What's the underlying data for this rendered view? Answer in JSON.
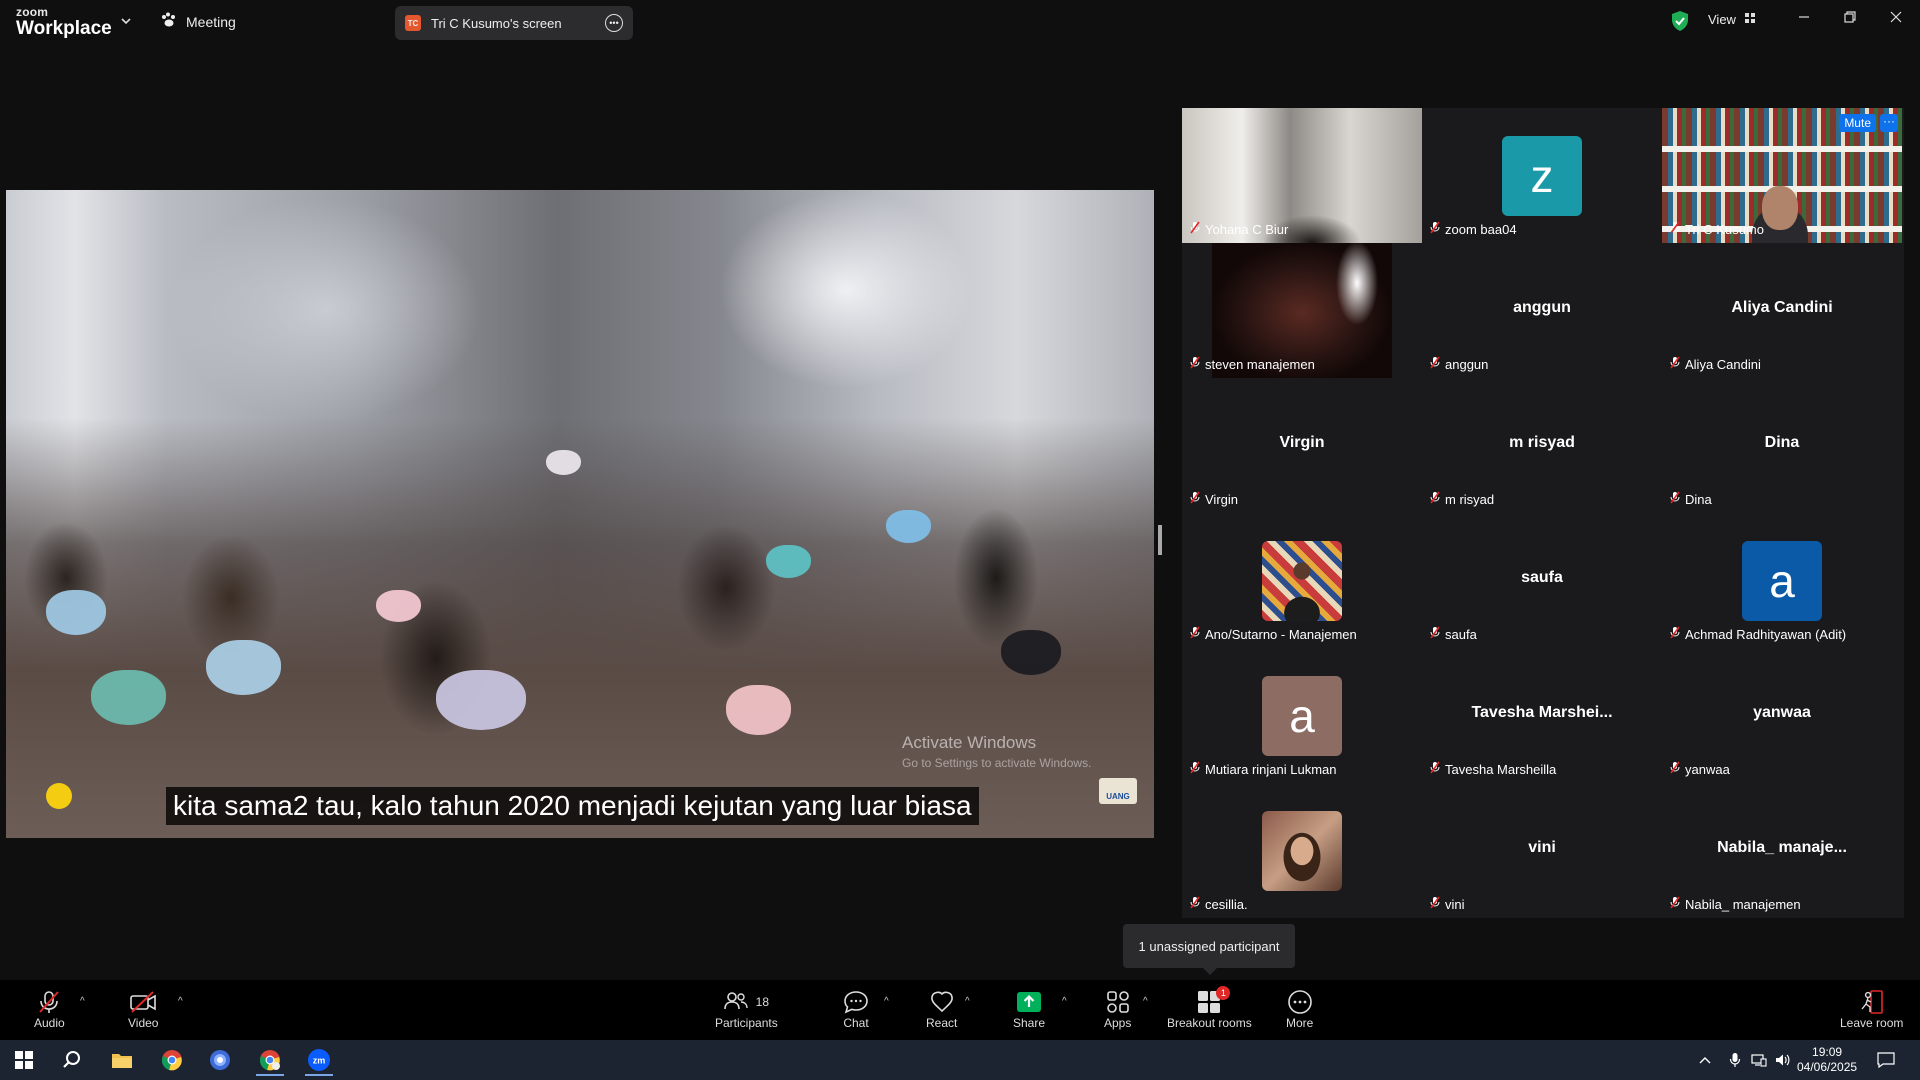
{
  "titlebar": {
    "brand_top": "zoom",
    "brand_bottom": "Workplace",
    "meeting_label": "Meeting",
    "share_tab_initials": "TC",
    "share_tab_label": "Tri C Kusumo's screen",
    "view_label": "View"
  },
  "shared_screen": {
    "caption": "kita sama2 tau, kalo tahun 2020 menjadi kejutan yang luar biasa",
    "watermark_title": "Activate Windows",
    "watermark_sub": "Go to Settings to activate Windows.",
    "logo_text": "UANG"
  },
  "gallery": {
    "mute_label": "Mute",
    "tiles": [
      {
        "name": "Yohana C Biur",
        "display": "",
        "type": "video"
      },
      {
        "name": "zoom baa04",
        "display": "z",
        "type": "avatar",
        "color": "#1a9aa8"
      },
      {
        "name": "Tri C Kusumo",
        "display": "",
        "type": "video",
        "active": true
      },
      {
        "name": "steven manajemen",
        "display": "",
        "type": "video"
      },
      {
        "name": "anggun",
        "display": "anggun",
        "type": "text"
      },
      {
        "name": "Aliya Candini",
        "display": "Aliya Candini",
        "type": "text"
      },
      {
        "name": "Virgin",
        "display": "Virgin",
        "type": "text"
      },
      {
        "name": "m risyad",
        "display": "m risyad",
        "type": "text"
      },
      {
        "name": "Dina",
        "display": "Dina",
        "type": "text"
      },
      {
        "name": "Ano/Sutarno - Manajemen",
        "display": "",
        "type": "photo"
      },
      {
        "name": "saufa",
        "display": "saufa",
        "type": "text"
      },
      {
        "name": "Achmad Radhityawan (Adit)",
        "display": "a",
        "type": "avatar",
        "color": "#0b5aa8"
      },
      {
        "name": "Mutiara rinjani Lukman",
        "display": "a",
        "type": "avatar",
        "color": "#8c6c63"
      },
      {
        "name": "Tavesha Marsheilla",
        "display": "Tavesha  Marshei...",
        "type": "text"
      },
      {
        "name": "yanwaa",
        "display": "yanwaa",
        "type": "text"
      },
      {
        "name": "cesillia.",
        "display": "",
        "type": "photo"
      },
      {
        "name": "vini",
        "display": "vini",
        "type": "text"
      },
      {
        "name": "Nabila_ manajemen",
        "display": "Nabila_  manaje...",
        "type": "text"
      }
    ]
  },
  "tooltip": "1 unassigned participant",
  "toolbar": {
    "audio": "Audio",
    "video": "Video",
    "participants": "Participants",
    "participants_count": "18",
    "chat": "Chat",
    "react": "React",
    "share": "Share",
    "apps": "Apps",
    "breakout": "Breakout rooms",
    "breakout_badge": "1",
    "more": "More",
    "leave": "Leave room"
  },
  "taskbar": {
    "time": "19:09",
    "date": "04/06/2025"
  },
  "colors": {
    "accent": "#0e72ed",
    "active_speaker": "#22c55e",
    "share_green": "#00b05a",
    "muted_red": "#e02828"
  }
}
